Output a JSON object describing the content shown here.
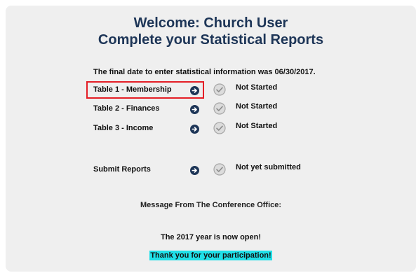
{
  "header": {
    "line1": "Welcome: Church User",
    "line2": "Complete your Statistical Reports"
  },
  "deadline_text": "The final date to enter statistical information was 06/30/2017.",
  "tables": [
    {
      "label": "Table 1 - Membership",
      "status": "Not Started",
      "highlighted": true
    },
    {
      "label": "Table 2 - Finances",
      "status": "Not Started",
      "highlighted": false
    },
    {
      "label": "Table 3 - Income",
      "status": "Not Started",
      "highlighted": false
    }
  ],
  "submit": {
    "label": "Submit Reports",
    "status": "Not yet submitted"
  },
  "message": {
    "heading": "Message From The Conference Office:",
    "line1": "The 2017 year is now open!",
    "line2": "Thank you for your participation!"
  },
  "icons": {
    "arrow": "arrow-right-circle-icon",
    "status": "check-circle-icon"
  },
  "colors": {
    "accent": "#1d3557",
    "highlight_border": "#e41e26",
    "thanks_background": "#20e0e8",
    "panel_background": "#efefef"
  }
}
